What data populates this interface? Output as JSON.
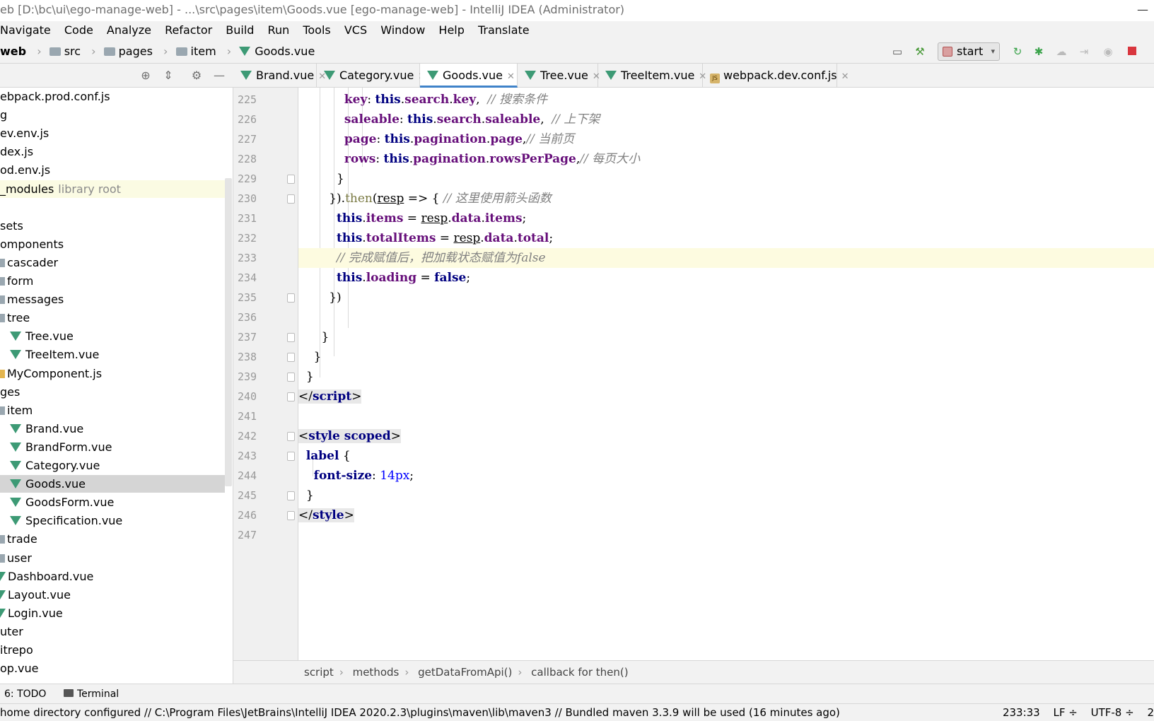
{
  "window": {
    "title": "eb [D:\\bc\\ui\\ego-manage-web] - ...\\src\\pages\\item\\Goods.vue [ego-manage-web] - IntelliJ IDEA (Administrator)"
  },
  "menu": [
    "Navigate",
    "Code",
    "Analyze",
    "Refactor",
    "Build",
    "Run",
    "Tools",
    "VCS",
    "Window",
    "Help",
    "Translate"
  ],
  "nav": {
    "crumbs": [
      "web",
      "src",
      "pages",
      "item",
      "Goods.vue"
    ],
    "run_config": "start"
  },
  "project_tree": [
    {
      "label": "ebpack.prod.conf.js",
      "indent": 0,
      "icon": "none"
    },
    {
      "label": "g",
      "indent": 0,
      "icon": "none"
    },
    {
      "label": "ev.env.js",
      "indent": 0,
      "icon": "none"
    },
    {
      "label": "dex.js",
      "indent": 0,
      "icon": "none"
    },
    {
      "label": "od.env.js",
      "indent": 0,
      "icon": "none"
    },
    {
      "label": "_modules",
      "indent": 0,
      "icon": "none",
      "extra": "library root",
      "libroot": true
    },
    {
      "label": "",
      "indent": 0,
      "icon": "none"
    },
    {
      "label": "sets",
      "indent": 0,
      "icon": "none"
    },
    {
      "label": "omponents",
      "indent": 0,
      "icon": "none"
    },
    {
      "label": "cascader",
      "indent": 1,
      "icon": "dir"
    },
    {
      "label": "form",
      "indent": 1,
      "icon": "dir"
    },
    {
      "label": "messages",
      "indent": 1,
      "icon": "dir"
    },
    {
      "label": "tree",
      "indent": 1,
      "icon": "dir"
    },
    {
      "label": "Tree.vue",
      "indent": 2,
      "icon": "vue"
    },
    {
      "label": "TreeItem.vue",
      "indent": 2,
      "icon": "vue"
    },
    {
      "label": "MyComponent.js",
      "indent": 1,
      "icon": "js"
    },
    {
      "label": "ges",
      "indent": 0,
      "icon": "none"
    },
    {
      "label": "item",
      "indent": 1,
      "icon": "dir"
    },
    {
      "label": "Brand.vue",
      "indent": 2,
      "icon": "vue"
    },
    {
      "label": "BrandForm.vue",
      "indent": 2,
      "icon": "vue"
    },
    {
      "label": "Category.vue",
      "indent": 2,
      "icon": "vue"
    },
    {
      "label": "Goods.vue",
      "indent": 2,
      "icon": "vue",
      "selected": true
    },
    {
      "label": "GoodsForm.vue",
      "indent": 2,
      "icon": "vue"
    },
    {
      "label": "Specification.vue",
      "indent": 2,
      "icon": "vue"
    },
    {
      "label": "trade",
      "indent": 1,
      "icon": "dir"
    },
    {
      "label": "user",
      "indent": 1,
      "icon": "dir"
    },
    {
      "label": "Dashboard.vue",
      "indent": 1,
      "icon": "vue"
    },
    {
      "label": "Layout.vue",
      "indent": 1,
      "icon": "vue"
    },
    {
      "label": "Login.vue",
      "indent": 1,
      "icon": "vue"
    },
    {
      "label": "uter",
      "indent": 0,
      "icon": "none"
    },
    {
      "label": "itrepo",
      "indent": 0,
      "icon": "none"
    },
    {
      "label": "op.vue",
      "indent": 0,
      "icon": "none"
    }
  ],
  "tabs": [
    {
      "label": "Brand.vue",
      "icon": "vue"
    },
    {
      "label": "Category.vue",
      "icon": "vue"
    },
    {
      "label": "Goods.vue",
      "icon": "vue",
      "active": true
    },
    {
      "label": "Tree.vue",
      "icon": "vue"
    },
    {
      "label": "TreeItem.vue",
      "icon": "vue"
    },
    {
      "label": "webpack.dev.conf.js",
      "icon": "js"
    }
  ],
  "code": {
    "lines": [
      {
        "n": "225"
      },
      {
        "n": "226"
      },
      {
        "n": "227"
      },
      {
        "n": "228"
      },
      {
        "n": "229"
      },
      {
        "n": "230"
      },
      {
        "n": "231"
      },
      {
        "n": "232"
      },
      {
        "n": "233"
      },
      {
        "n": "234"
      },
      {
        "n": "235"
      },
      {
        "n": "236"
      },
      {
        "n": "237"
      },
      {
        "n": "238"
      },
      {
        "n": "239"
      },
      {
        "n": "240"
      },
      {
        "n": "241"
      },
      {
        "n": "242"
      },
      {
        "n": "243"
      },
      {
        "n": "244"
      },
      {
        "n": "245"
      },
      {
        "n": "246"
      },
      {
        "n": "247"
      }
    ],
    "text": {
      "l225_key": "key",
      "l225_rest": "this.search.key,",
      "l225_cm": "// 搜索条件",
      "l226_key": "saleable",
      "l226_rest": "this.search.saleable,",
      "l226_cm": "// 上下架",
      "l227_key": "page",
      "l227_rest": "this.pagination.page,",
      "l227_cm": "// 当前页",
      "l228_key": "rows",
      "l228_rest": "this.pagination.rowsPerPage,",
      "l228_cm": "// 每页大小",
      "l229": "}",
      "l230_a": "}).",
      "l230_then": "then",
      "l230_resp": "resp",
      "l230_arrow": " => {",
      "l230_cm": "// 这里使用箭头函数",
      "l231_a": "this.items",
      "l231_eq": " = ",
      "l231_resp": "resp",
      "l231_b": ".data.items;",
      "l232_a": "this.totalItems",
      "l232_eq": " = ",
      "l232_resp": "resp",
      "l232_b": ".data.total;",
      "l233_cm": "// 完成赋值后，把加载状态赋值为false",
      "l234_a": "this.loading",
      "l234_eq": " = ",
      "l234_false": "false",
      "l234_semi": ";",
      "l235": "})",
      "l237": "}",
      "l238": "}",
      "l239": "}",
      "l240_open": "</",
      "l240_tag": "script",
      "l240_close": ">",
      "l242_open": "<",
      "l242_tag": "style scoped",
      "l242_close": ">",
      "l243_sel": "label",
      "l243_brace": " {",
      "l244_prop": "font-size",
      "l244_colon": ": ",
      "l244_val": "14px",
      "l244_semi": ";",
      "l245": "}",
      "l246_open": "</",
      "l246_tag": "style",
      "l246_close": ">"
    }
  },
  "code_breadcrumb": [
    "script",
    "methods",
    "getDataFromApi()",
    "callback for then()"
  ],
  "toolwindows": {
    "todo": "6: TODO",
    "terminal": "Terminal"
  },
  "status": {
    "message": "home directory configured // C:\\Program Files\\JetBrains\\IntelliJ IDEA 2020.2.3\\plugins\\maven\\lib\\maven3 // Bundled maven 3.3.9 will be used (16 minutes ago)",
    "position": "233:33",
    "line_sep": "LF ÷",
    "encoding": "UTF-8 ÷",
    "extra": "2"
  }
}
